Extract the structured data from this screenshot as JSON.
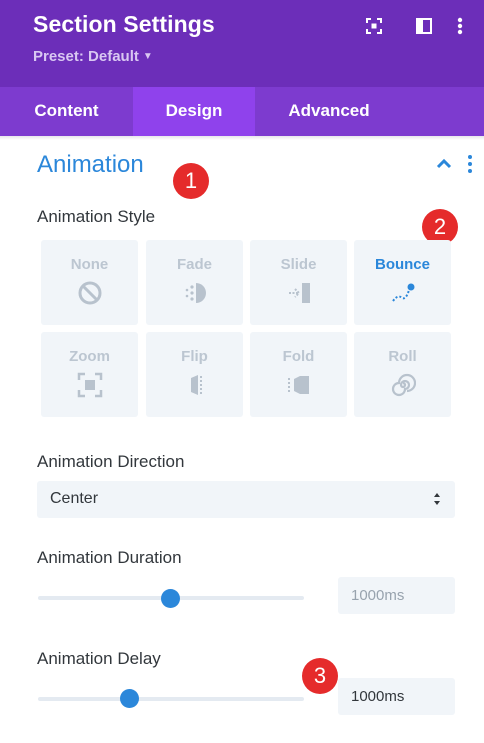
{
  "header": {
    "title": "Section Settings",
    "preset": "Preset: Default",
    "icons": [
      "focus-icon",
      "split-view-icon",
      "more-vertical-icon"
    ],
    "background": "#6c2eb9"
  },
  "tabs": [
    {
      "label": "Content",
      "active": false
    },
    {
      "label": "Design",
      "active": true
    },
    {
      "label": "Advanced",
      "active": false
    }
  ],
  "section": {
    "title": "Animation",
    "accent": "#2b87da"
  },
  "badges": [
    "1",
    "2",
    "3"
  ],
  "animation_style": {
    "label": "Animation Style",
    "options": [
      {
        "label": "None",
        "icon": "none-icon",
        "selected": false
      },
      {
        "label": "Fade",
        "icon": "fade-icon",
        "selected": false
      },
      {
        "label": "Slide",
        "icon": "slide-icon",
        "selected": false
      },
      {
        "label": "Bounce",
        "icon": "bounce-icon",
        "selected": true
      },
      {
        "label": "Zoom",
        "icon": "zoom-icon",
        "selected": false
      },
      {
        "label": "Flip",
        "icon": "flip-icon",
        "selected": false
      },
      {
        "label": "Fold",
        "icon": "fold-icon",
        "selected": false
      },
      {
        "label": "Roll",
        "icon": "roll-icon",
        "selected": false
      }
    ]
  },
  "animation_direction": {
    "label": "Animation Direction",
    "value": "Center"
  },
  "animation_duration": {
    "label": "Animation Duration",
    "value": "1000ms"
  },
  "animation_delay": {
    "label": "Animation Delay",
    "value": "1000ms"
  }
}
